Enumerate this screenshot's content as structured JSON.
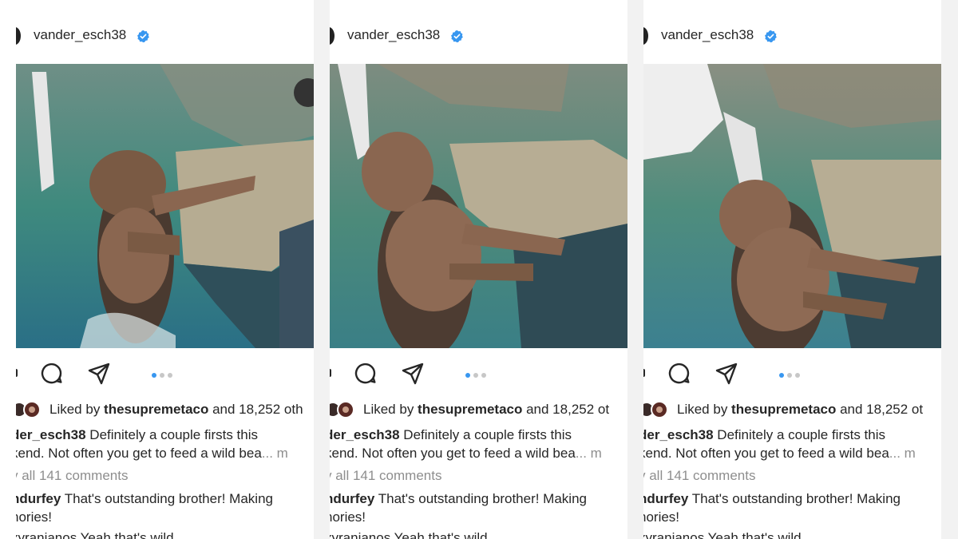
{
  "panels": [
    {
      "username": "vander_esch38",
      "liked_prefix": "Liked by ",
      "liked_user": "thesupremetaco",
      "liked_suffix": " and 18,252 oth",
      "caption_user": "der_esch38",
      "caption_line1": " Definitely a couple firsts this",
      "caption_line2": "kend. Not often you get to feed a wild bea",
      "caption_more": "... m",
      "view_comments": "v all 141 comments",
      "reply_user": "ndurfey",
      "reply_line1": " That's outstanding brother! Making",
      "reply_line2": "nories!",
      "cutoff_line": "xyranianos Yeah that's wild"
    },
    {
      "username": "vander_esch38",
      "liked_prefix": "Liked by ",
      "liked_user": "thesupremetaco",
      "liked_suffix": " and 18,252 ot",
      "caption_user": "der_esch38",
      "caption_line1": " Definitely a couple firsts this",
      "caption_line2": "kend. Not often you get to feed a wild bea",
      "caption_more": "... m",
      "view_comments": "v all 141 comments",
      "reply_user": "ndurfey",
      "reply_line1": " That's outstanding brother! Making",
      "reply_line2": "nories!",
      "cutoff_line": "xyranianos Yeah that's wild"
    },
    {
      "username": "vander_esch38",
      "liked_prefix": "Liked by ",
      "liked_user": "thesupremetaco",
      "liked_suffix": " and 18,252 ot",
      "caption_user": "der_esch38",
      "caption_line1": " Definitely a couple firsts this",
      "caption_line2": "kend. Not often you get to feed a wild bea",
      "caption_more": "... m",
      "view_comments": "v all 141 comments",
      "reply_user": "ndurfey",
      "reply_line1": " That's outstanding brother! Making",
      "reply_line2": "nories!",
      "cutoff_line": "xyranianos Yeah that's wild"
    }
  ],
  "icons": {
    "verified": "verified-badge-icon",
    "comment": "comment-icon",
    "share": "share-icon",
    "carousel": "carousel-dots"
  },
  "colors": {
    "verified_blue": "#3897f0",
    "text": "#262626",
    "muted": "#8e8e8e",
    "water": "#4f8a84",
    "bear": "#7a5a44"
  },
  "carousel": {
    "active_index": 0,
    "count": 3
  }
}
